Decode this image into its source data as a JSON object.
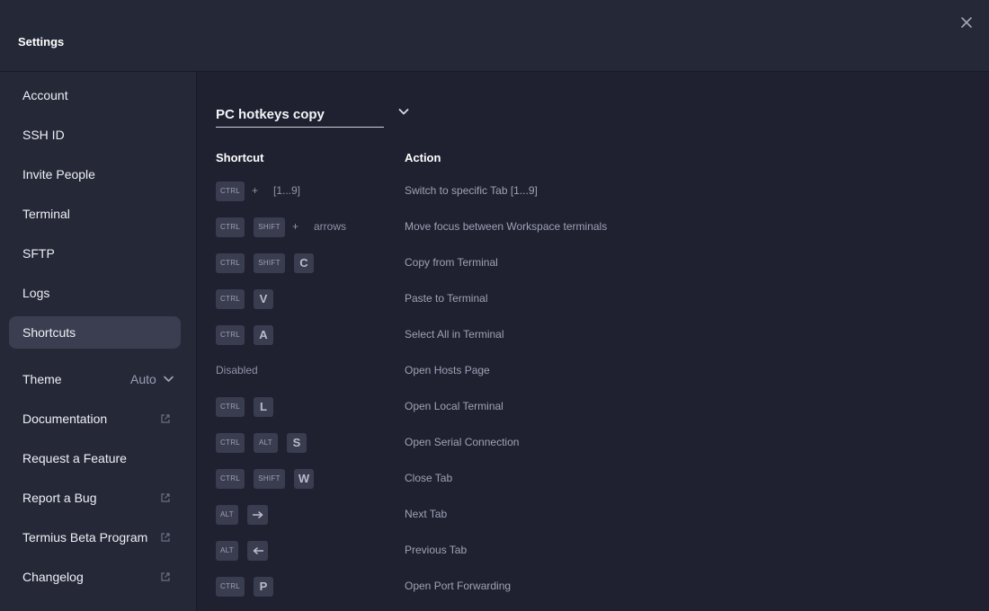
{
  "header": {
    "title": "Settings",
    "close_icon": "close-icon"
  },
  "sidebar": {
    "items": [
      {
        "label": "Account"
      },
      {
        "label": "SSH ID"
      },
      {
        "label": "Invite People"
      },
      {
        "label": "Terminal"
      },
      {
        "label": "SFTP"
      },
      {
        "label": "Logs"
      },
      {
        "label": "Shortcuts",
        "active": true
      },
      {
        "label": "Theme",
        "value": "Auto"
      },
      {
        "label": "Documentation",
        "external": true
      },
      {
        "label": "Request a Feature"
      },
      {
        "label": "Report a Bug",
        "external": true
      },
      {
        "label": "Termius Beta Program",
        "external": true
      },
      {
        "label": "Changelog",
        "external": true
      }
    ]
  },
  "main": {
    "preset": "PC hotkeys copy",
    "columns": {
      "shortcut": "Shortcut",
      "action": "Action"
    },
    "rows": [
      {
        "action": "Switch to specific Tab [1...9]",
        "k1": "CTRL",
        "plus": "+",
        "range": "[1...9]"
      },
      {
        "action": "Move focus between Workspace terminals",
        "k1": "CTRL",
        "k2": "SHIFT",
        "plus": "+",
        "arrows": "arrows"
      },
      {
        "action": "Copy from Terminal",
        "k1": "CTRL",
        "k2": "SHIFT",
        "k3": "C"
      },
      {
        "action": "Paste to Terminal",
        "k1": "CTRL",
        "k2": "V"
      },
      {
        "action": "Select All in Terminal",
        "k1": "CTRL",
        "k2": "A"
      },
      {
        "action": "Open Hosts Page",
        "disabled": "Disabled"
      },
      {
        "action": "Open Local Terminal",
        "k1": "CTRL",
        "k2": "L"
      },
      {
        "action": "Open Serial Connection",
        "k1": "CTRL",
        "k2": "ALT",
        "k3": "S"
      },
      {
        "action": "Close Tab",
        "k1": "CTRL",
        "k2": "SHIFT",
        "k3": "W"
      },
      {
        "action": "Next Tab",
        "k1": "ALT",
        "k2_icon": "arrow-right-icon"
      },
      {
        "action": "Previous Tab",
        "k1": "ALT",
        "k2_icon": "arrow-left-icon"
      },
      {
        "action": "Open Port Forwarding",
        "k1": "CTRL",
        "k2": "P"
      }
    ]
  },
  "colors": {
    "background": "#1f2130",
    "sidebar": "#252837",
    "active_item": "#3b3e50",
    "key_cap": "#3a3d4f"
  }
}
